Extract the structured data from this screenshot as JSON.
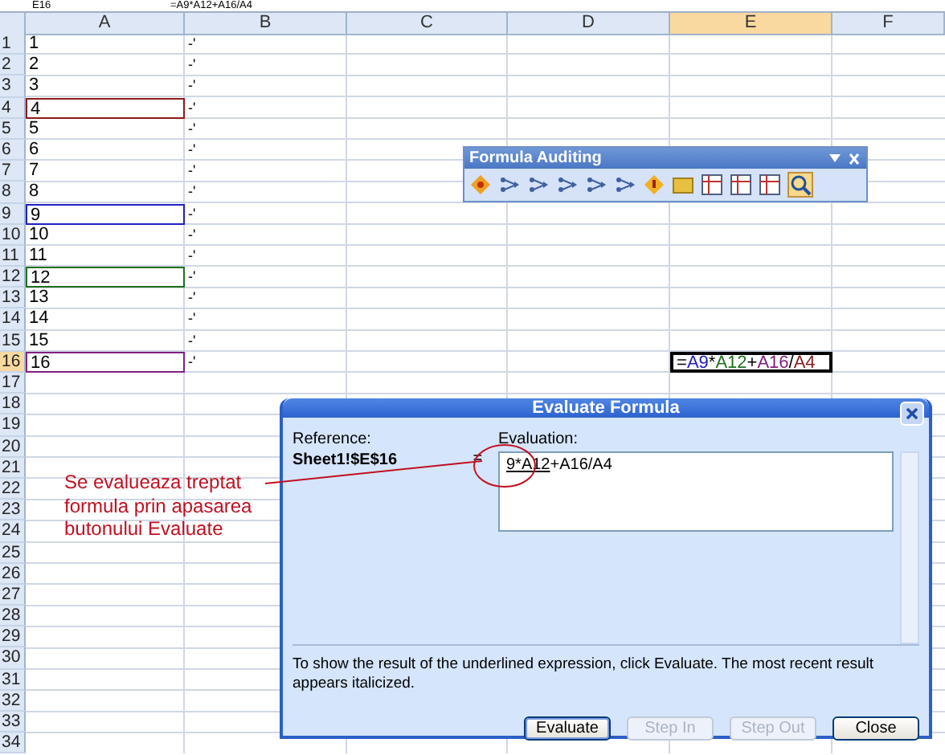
{
  "formula_bar": {
    "name_box": "E16",
    "formula": "=A9*A12+A16/A4"
  },
  "columns": [
    {
      "label": "A",
      "selected": false
    },
    {
      "label": "B",
      "selected": false
    },
    {
      "label": "C",
      "selected": false
    },
    {
      "label": "D",
      "selected": false
    },
    {
      "label": "E",
      "selected": true
    },
    {
      "label": "F",
      "selected": false
    }
  ],
  "rows": [
    {
      "header": "1",
      "a": "1",
      "b": "-'",
      "selected": false
    },
    {
      "header": "2",
      "a": "2",
      "b": "-'",
      "selected": false
    },
    {
      "header": "3",
      "a": "3",
      "b": "-'",
      "selected": false
    },
    {
      "header": "4",
      "a": "4",
      "b": "-'",
      "selected": false,
      "color": "#8b1a1a"
    },
    {
      "header": "5",
      "a": "5",
      "b": "-'",
      "selected": false
    },
    {
      "header": "6",
      "a": "6",
      "b": "-'",
      "selected": false
    },
    {
      "header": "7",
      "a": "7",
      "b": "-'",
      "selected": false
    },
    {
      "header": "8",
      "a": "8",
      "b": "-'",
      "selected": false
    },
    {
      "header": "9",
      "a": "9",
      "b": "-'",
      "selected": false,
      "color": "#2020c0"
    },
    {
      "header": "10",
      "a": "10",
      "b": "-'",
      "selected": false
    },
    {
      "header": "11",
      "a": "11",
      "b": "-'",
      "selected": false
    },
    {
      "header": "12",
      "a": "12",
      "b": "-'",
      "selected": false,
      "color": "#207020"
    },
    {
      "header": "13",
      "a": "13",
      "b": "-'",
      "selected": false
    },
    {
      "header": "14",
      "a": "14",
      "b": "-'",
      "selected": false
    },
    {
      "header": "15",
      "a": "15",
      "b": "-'",
      "selected": false
    },
    {
      "header": "16",
      "a": "16",
      "b": "-'",
      "selected": true,
      "color": "#802080",
      "e": [
        {
          "text": "=",
          "color": "#000000"
        },
        {
          "text": "A9",
          "color": "#2020c0"
        },
        {
          "text": "*",
          "color": "#000000"
        },
        {
          "text": "A12",
          "color": "#207020"
        },
        {
          "text": "+",
          "color": "#000000"
        },
        {
          "text": "A16",
          "color": "#802080"
        },
        {
          "text": "/",
          "color": "#000000"
        },
        {
          "text": "A4",
          "color": "#8b1a1a"
        }
      ]
    },
    {
      "header": "17",
      "selected": false
    },
    {
      "header": "18",
      "selected": false
    },
    {
      "header": "19",
      "selected": false
    },
    {
      "header": "20",
      "selected": false
    },
    {
      "header": "21",
      "selected": false
    },
    {
      "header": "22",
      "selected": false
    },
    {
      "header": "23",
      "selected": false
    },
    {
      "header": "24",
      "selected": false
    },
    {
      "header": "25",
      "selected": false
    },
    {
      "header": "26",
      "selected": false
    },
    {
      "header": "27",
      "selected": false
    },
    {
      "header": "28",
      "selected": false
    },
    {
      "header": "29",
      "selected": false
    },
    {
      "header": "30",
      "selected": false
    },
    {
      "header": "31",
      "selected": false
    },
    {
      "header": "32",
      "selected": false
    },
    {
      "header": "33",
      "selected": false
    },
    {
      "header": "34",
      "selected": false
    }
  ],
  "toolbar": {
    "title": "Formula Auditing"
  },
  "dialog": {
    "title": "Evaluate Formula",
    "reference_label": "Reference:",
    "reference": "Sheet1!$E$16",
    "equals": "=",
    "evaluation_label": "Evaluation:",
    "evaluation_underlined": "9*A12",
    "evaluation_rest": "+A16/A4",
    "hint": "To show the result of the underlined expression, click Evaluate.  The most recent result appears italicized.",
    "buttons": [
      {
        "label": "Evaluate",
        "disabled": false
      },
      {
        "label": "Step In",
        "disabled": true
      },
      {
        "label": "Step Out",
        "disabled": true
      },
      {
        "label": "Close",
        "disabled": false
      }
    ]
  },
  "annotation": {
    "text": "Se evalueaza treptat formula prin apasarea butonului Evaluate"
  }
}
